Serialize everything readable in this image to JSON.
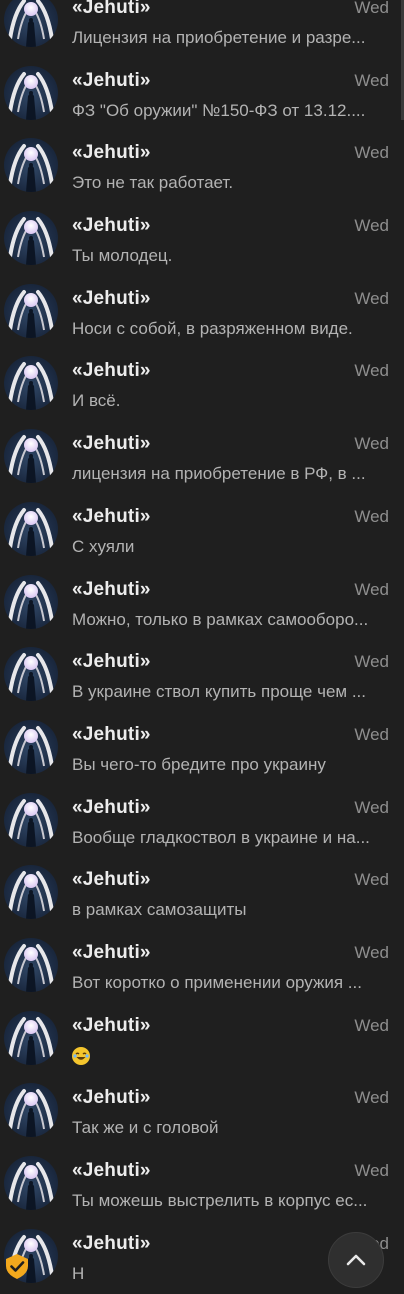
{
  "conversations": [
    {
      "name": "«Jehuti»",
      "date": "Wed",
      "preview": "Лицензия на приобретение и разре..."
    },
    {
      "name": "«Jehuti»",
      "date": "Wed",
      "preview": "ФЗ \"Об оружии\" №150-ФЗ от 13.12...."
    },
    {
      "name": "«Jehuti»",
      "date": "Wed",
      "preview": "Это не так работает."
    },
    {
      "name": "«Jehuti»",
      "date": "Wed",
      "preview": "Ты молодец."
    },
    {
      "name": "«Jehuti»",
      "date": "Wed",
      "preview": "Носи с собой, в разряженном виде."
    },
    {
      "name": "«Jehuti»",
      "date": "Wed",
      "preview": "И всё."
    },
    {
      "name": "«Jehuti»",
      "date": "Wed",
      "preview": "лицензия на приобретение в РФ, в ..."
    },
    {
      "name": "«Jehuti»",
      "date": "Wed",
      "preview": "С хуяли"
    },
    {
      "name": "«Jehuti»",
      "date": "Wed",
      "preview": "Можно, только в рамках самооборо..."
    },
    {
      "name": "«Jehuti»",
      "date": "Wed",
      "preview": "В украине ствол купить проще чем ..."
    },
    {
      "name": "«Jehuti»",
      "date": "Wed",
      "preview": "Вы чего-то бредите про украину"
    },
    {
      "name": "«Jehuti»",
      "date": "Wed",
      "preview": "Вообще гладкоствол в украине и на..."
    },
    {
      "name": "«Jehuti»",
      "date": "Wed",
      "preview": "в рамках самозащиты"
    },
    {
      "name": "«Jehuti»",
      "date": "Wed",
      "preview": "Вот коротко о применении оружия ..."
    },
    {
      "name": "«Jehuti»",
      "date": "Wed",
      "preview": "",
      "emoji": "laughing-emoji"
    },
    {
      "name": "«Jehuti»",
      "date": "Wed",
      "preview": "Так же и с головой"
    },
    {
      "name": "«Jehuti»",
      "date": "Wed",
      "preview": "Ты можешь выстрелить в корпус ес..."
    },
    {
      "name": "«Jehuti»",
      "date": "Wed",
      "preview": "Н"
    }
  ],
  "icons": {
    "scroll_top": "chevron-up-icon",
    "badge": "shield-check-icon"
  },
  "colors": {
    "background": "#1f1f1f",
    "name": "#ececec",
    "date": "#8e8e8e",
    "preview": "#b3b3b3",
    "badge": "#f2a81d"
  }
}
